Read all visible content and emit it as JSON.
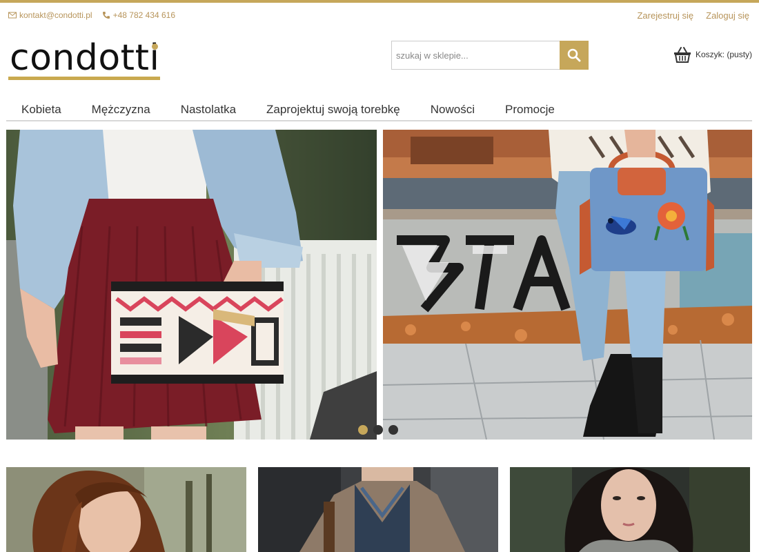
{
  "contact": {
    "email": "kontakt@condotti.pl",
    "phone": "+48 782 434 616"
  },
  "account": {
    "register": "Zarejestruj się",
    "login": "Zaloguj się"
  },
  "brand": {
    "name": "condotti",
    "accent_color": "#c6a75a"
  },
  "search": {
    "placeholder": "szukaj w sklepie...",
    "icon": "search-icon"
  },
  "cart": {
    "label": "Koszyk:",
    "status": "(pusty)",
    "icon": "basket-icon"
  },
  "nav": {
    "items": [
      {
        "label": "Kobieta"
      },
      {
        "label": "Mężczyzna"
      },
      {
        "label": "Nastolatka"
      },
      {
        "label": "Zaprojektuj swoją torebkę"
      },
      {
        "label": "Nowości"
      },
      {
        "label": "Promocje"
      }
    ]
  },
  "slider": {
    "slide_count": 3,
    "active_index": 0
  }
}
